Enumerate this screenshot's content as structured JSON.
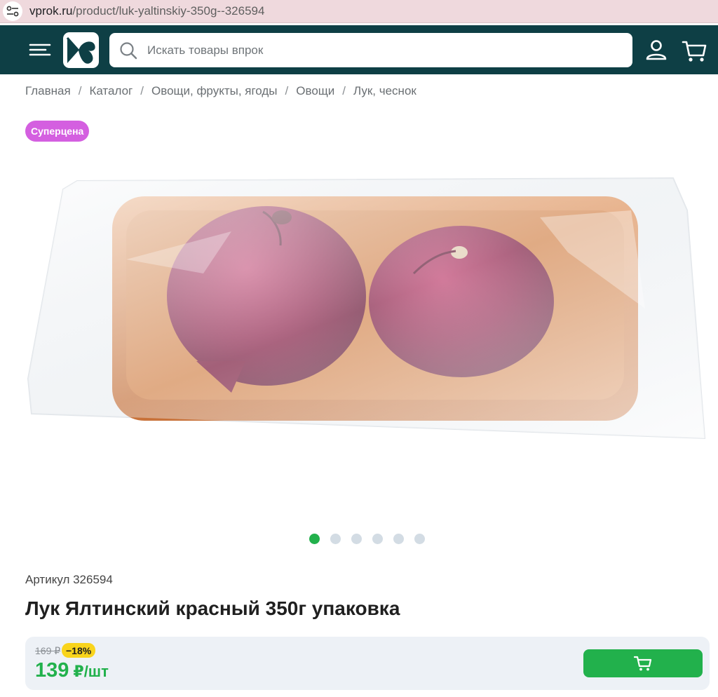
{
  "browser": {
    "url_host": "vprok.ru",
    "url_path": "/product/luk-yaltinskiy-350g--326594"
  },
  "header": {
    "search_placeholder": "Искать товары впрок",
    "icons": [
      "menu-icon",
      "logo-icon",
      "search-icon",
      "user-icon",
      "cart-icon"
    ],
    "background_color": "#0e3f45"
  },
  "breadcrumb": [
    "Главная",
    "Каталог",
    "Овощи, фрукты, ягоды",
    "Овощи",
    "Лук, чеснок"
  ],
  "badge": "Суперцена",
  "gallery": {
    "slides_total": 6,
    "active_slide": 1
  },
  "product": {
    "sku_label": "Артикул 326594",
    "title": "Лук Ялтинский красный 350г упаковка"
  },
  "price": {
    "old": "169 ₽",
    "discount": "−18%",
    "current": "139",
    "unit": "₽/шт",
    "accent_color": "#22b14c"
  }
}
